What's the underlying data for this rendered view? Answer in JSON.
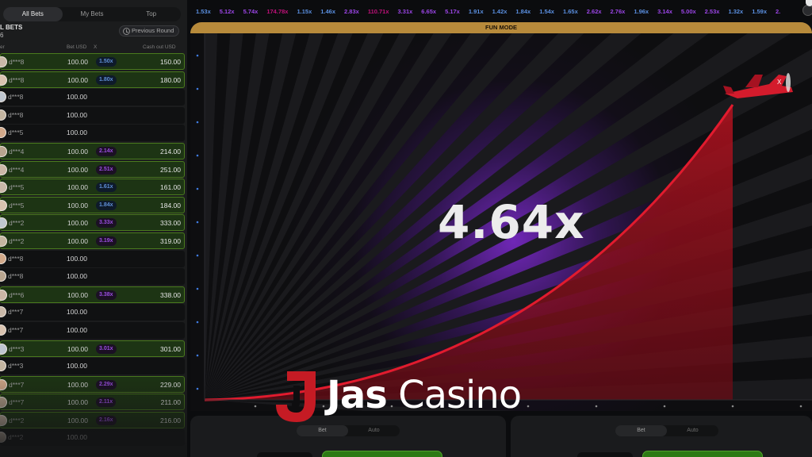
{
  "tabs": [
    {
      "label": "All Bets",
      "active": true
    },
    {
      "label": "My Bets",
      "active": false
    },
    {
      "label": "Top",
      "active": false
    }
  ],
  "all_bets_title": "L BETS",
  "bets_count": "6",
  "previous_round_label": "Previous Round",
  "columns": {
    "player": "er",
    "bet": "Bet USD",
    "x": "X",
    "cashout": "Cash out USD"
  },
  "bets": [
    {
      "player": "d***8",
      "bet": "100.00",
      "mult": "1.50x",
      "cashout": "150.00",
      "win": true,
      "tone": "blue"
    },
    {
      "player": "d***8",
      "bet": "100.00",
      "mult": "1.80x",
      "cashout": "180.00",
      "win": true,
      "tone": "blue"
    },
    {
      "player": "d***8",
      "bet": "100.00",
      "mult": "",
      "cashout": "",
      "win": false,
      "tone": "blue"
    },
    {
      "player": "d***8",
      "bet": "100.00",
      "mult": "",
      "cashout": "",
      "win": false,
      "tone": "blue"
    },
    {
      "player": "d***5",
      "bet": "100.00",
      "mult": "",
      "cashout": "",
      "win": false,
      "tone": "blue"
    },
    {
      "player": "d***4",
      "bet": "100.00",
      "mult": "2.14x",
      "cashout": "214.00",
      "win": true,
      "tone": "purple"
    },
    {
      "player": "d***4",
      "bet": "100.00",
      "mult": "2.51x",
      "cashout": "251.00",
      "win": true,
      "tone": "purple"
    },
    {
      "player": "d***5",
      "bet": "100.00",
      "mult": "1.61x",
      "cashout": "161.00",
      "win": true,
      "tone": "blue"
    },
    {
      "player": "d***5",
      "bet": "100.00",
      "mult": "1.84x",
      "cashout": "184.00",
      "win": true,
      "tone": "blue"
    },
    {
      "player": "d***2",
      "bet": "100.00",
      "mult": "3.33x",
      "cashout": "333.00",
      "win": true,
      "tone": "purple"
    },
    {
      "player": "d***2",
      "bet": "100.00",
      "mult": "3.19x",
      "cashout": "319.00",
      "win": true,
      "tone": "purple"
    },
    {
      "player": "d***8",
      "bet": "100.00",
      "mult": "",
      "cashout": "",
      "win": false,
      "tone": "blue"
    },
    {
      "player": "d***8",
      "bet": "100.00",
      "mult": "",
      "cashout": "",
      "win": false,
      "tone": "blue"
    },
    {
      "player": "d***6",
      "bet": "100.00",
      "mult": "3.38x",
      "cashout": "338.00",
      "win": true,
      "tone": "purple"
    },
    {
      "player": "d***7",
      "bet": "100.00",
      "mult": "",
      "cashout": "",
      "win": false,
      "tone": "blue"
    },
    {
      "player": "d***7",
      "bet": "100.00",
      "mult": "",
      "cashout": "",
      "win": false,
      "tone": "blue"
    },
    {
      "player": "d***3",
      "bet": "100.00",
      "mult": "3.01x",
      "cashout": "301.00",
      "win": true,
      "tone": "purple"
    },
    {
      "player": "d***3",
      "bet": "100.00",
      "mult": "",
      "cashout": "",
      "win": false,
      "tone": "blue"
    },
    {
      "player": "d***7",
      "bet": "100.00",
      "mult": "2.29x",
      "cashout": "229.00",
      "win": true,
      "tone": "purple"
    },
    {
      "player": "d***7",
      "bet": "100.00",
      "mult": "2.11x",
      "cashout": "211.00",
      "win": true,
      "tone": "purple"
    },
    {
      "player": "d***2",
      "bet": "100.00",
      "mult": "2.16x",
      "cashout": "216.00",
      "win": true,
      "tone": "purple"
    },
    {
      "player": "d***2",
      "bet": "100.00",
      "mult": "",
      "cashout": "",
      "win": false,
      "tone": "blue"
    }
  ],
  "history": [
    {
      "value": "1.53x",
      "tone": "blue"
    },
    {
      "value": "5.12x",
      "tone": "purple"
    },
    {
      "value": "5.74x",
      "tone": "purple"
    },
    {
      "value": "174.78x",
      "tone": "pink"
    },
    {
      "value": "1.15x",
      "tone": "blue"
    },
    {
      "value": "1.46x",
      "tone": "blue"
    },
    {
      "value": "2.83x",
      "tone": "purple"
    },
    {
      "value": "110.71x",
      "tone": "pink"
    },
    {
      "value": "3.31x",
      "tone": "purple"
    },
    {
      "value": "6.65x",
      "tone": "purple"
    },
    {
      "value": "5.17x",
      "tone": "purple"
    },
    {
      "value": "1.91x",
      "tone": "blue"
    },
    {
      "value": "1.42x",
      "tone": "blue"
    },
    {
      "value": "1.84x",
      "tone": "blue"
    },
    {
      "value": "1.54x",
      "tone": "blue"
    },
    {
      "value": "1.65x",
      "tone": "blue"
    },
    {
      "value": "2.62x",
      "tone": "purple"
    },
    {
      "value": "2.76x",
      "tone": "purple"
    },
    {
      "value": "1.96x",
      "tone": "blue"
    },
    {
      "value": "3.14x",
      "tone": "purple"
    },
    {
      "value": "5.00x",
      "tone": "purple"
    },
    {
      "value": "2.53x",
      "tone": "purple"
    },
    {
      "value": "1.32x",
      "tone": "blue"
    },
    {
      "value": "1.59x",
      "tone": "blue"
    },
    {
      "value": "2.",
      "tone": "purple"
    }
  ],
  "fun_mode_label": "FUN MODE",
  "multiplier": "4.64x",
  "logo": {
    "bold": "Jas",
    "regular": " Casino"
  },
  "bet_panels": [
    {
      "tabs": [
        "Bet",
        "Auto"
      ]
    },
    {
      "tabs": [
        "Bet",
        "Auto"
      ]
    }
  ],
  "colors": {
    "blue": "#5a8fe0",
    "purple": "#9b45e6",
    "pink": "#c0117a",
    "win_row": "#1d3414",
    "fun_mode": "#b78a3b",
    "curve": "#d01a2c"
  }
}
